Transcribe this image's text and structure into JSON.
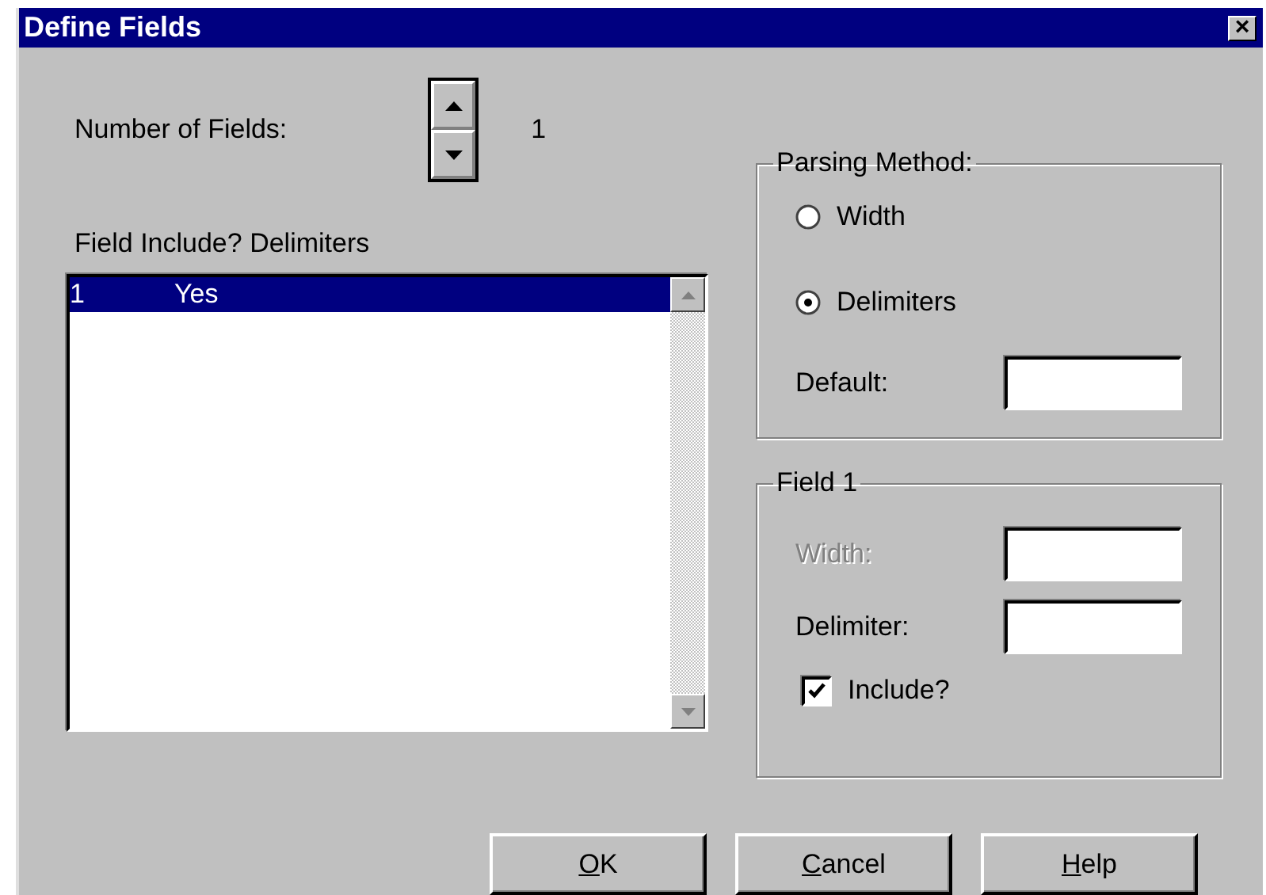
{
  "window": {
    "title": "Define Fields",
    "close": "×"
  },
  "number_of_fields": {
    "label": "Number of Fields:",
    "value": "1"
  },
  "list": {
    "header": "Field Include? Delimiters",
    "rows": [
      {
        "cells": [
          "1",
          "Yes"
        ],
        "selected": true
      }
    ]
  },
  "parsing_method": {
    "title": "Parsing Method:",
    "options": [
      {
        "label": "Width",
        "selected": false
      },
      {
        "label": "Delimiters",
        "selected": true
      }
    ],
    "default_label": "Default:"
  },
  "field_group": {
    "title": "Field 1",
    "fields": [
      {
        "label": "Width:",
        "disabled": true
      },
      {
        "label": "Delimiter:",
        "disabled": false
      }
    ],
    "include": {
      "label": "Include?",
      "checked": true
    }
  },
  "buttons": [
    "OK",
    "Cancel",
    "Help"
  ]
}
